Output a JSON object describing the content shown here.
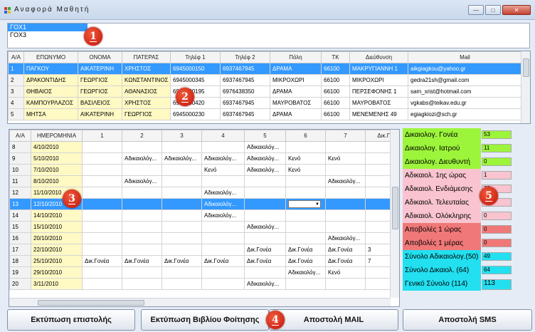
{
  "window": {
    "title": "Αναφορά Μαθητή",
    "icon": "app-icon"
  },
  "classes": {
    "items": [
      "ΓΟΧ1",
      "ΓΟΧ3"
    ],
    "selected": 0
  },
  "students": {
    "columns": [
      "Α/Α",
      "ΕΠΩΝΥΜΟ",
      "ΟΝΟΜΑ",
      "ΠΑΤΕΡΑΣ",
      "Τηλέφ 1",
      "Τηλέφ 2",
      "Πόλη",
      "ΤΚ",
      "Διεύθυνση",
      "Mail"
    ],
    "rows": [
      [
        "1",
        "ΠΑΓΚΟΥ",
        "ΑΙΚΑΤΕΡΙΝΗ",
        "ΧΡΗΣΤΟΣ",
        "6945000150",
        "6937467945",
        "ΔΡΑΜΑ",
        "66100",
        "ΜΑΚΡΥΓΙΑΝΝΗ 1",
        "aikgiagkou@yahoo.gr"
      ],
      [
        "2",
        "ΔΡΑΚΟΝΤΙΔΗΣ",
        "ΓΕΩΡΓΙΟΣ",
        "ΚΩΝΣΤΑΝΤΙΝΟΣ",
        "6945000345",
        "6937467945",
        "ΜΙΚΡΟΧΩΡΙ",
        "66100",
        "ΜΙΚΡΟΧΩΡΙ",
        "gedra21sh@gmail.com"
      ],
      [
        "3",
        "ΘΗΒΑΙΟΣ",
        "ΓΕΩΡΓΙΟΣ",
        "ΑΘΑΝΑΣΙΟΣ",
        "6945000195",
        "6976438350",
        "ΔΡΑΜΑ",
        "66100",
        "ΠΕΡΣΕΦΟΝΗΣ 1",
        "sam_xrist@hotmail.com"
      ],
      [
        "4",
        "ΚΑΜΠΟΥΡΛΑΖΟΣ",
        "ΒΑΣΙΛΕΙΟΣ",
        "ΧΡΗΣΤΟΣ",
        "6945000420",
        "6937467945",
        "ΜΑΥΡΟΒΑΤΟΣ",
        "66100",
        "ΜΑΥΡΟΒΑΤΟΣ",
        "vgkabs@teikav.edu.gr"
      ],
      [
        "5",
        "ΜΗΤΣΑ",
        "ΑΙΚΑΤΕΡΙΝΗ",
        "ΓΕΩΡΓΙΟΣ",
        "6945000230",
        "6937467945",
        "ΔΡΑΜΑ",
        "66100",
        "ΜΕΝΕΜΕΝΗΣ 49",
        "egiagkiozi@sch.gr"
      ]
    ],
    "selected_row": 0
  },
  "attendance": {
    "columns": [
      "Α/Α",
      "ΗΜΕΡΟΜΗΝΙΑ",
      "1",
      "2",
      "3",
      "4",
      "5",
      "6",
      "7",
      "Δικ.Γον"
    ],
    "rows": [
      [
        "8",
        "4/10/2010",
        "",
        "",
        "",
        "",
        "Αδικαιολόγ...",
        "",
        "",
        ""
      ],
      [
        "9",
        "5/10/2010",
        "",
        "Αδικαιολόγ...",
        "Αδικαιολόγ...",
        "Αδικαιολόγ...",
        "Αδικαιολόγ...",
        "Κενό",
        "Κενό",
        ""
      ],
      [
        "10",
        "7/10/2010",
        "",
        "",
        "",
        "Κενό",
        "Αδικαιολόγ...",
        "Κενό",
        "",
        ""
      ],
      [
        "11",
        "8/10/2010",
        "",
        "Αδικαιολόγ...",
        "",
        "",
        "",
        "",
        "Αδικαιολόγ...",
        ""
      ],
      [
        "12",
        "11/10/2010",
        "",
        "",
        "",
        "Αδικαιολόγ...",
        "",
        "",
        "",
        ""
      ],
      [
        "13",
        "12/10/2010",
        "",
        "",
        "",
        "Αδικαιολόγ...",
        "",
        "",
        "",
        ""
      ],
      [
        "14",
        "14/10/2010",
        "",
        "",
        "",
        "Αδικαιολόγ...",
        "",
        "",
        "",
        ""
      ],
      [
        "15",
        "15/10/2010",
        "",
        "",
        "",
        "",
        "Αδικαιολόγ...",
        "",
        "",
        ""
      ],
      [
        "16",
        "20/10/2010",
        "",
        "",
        "",
        "",
        "",
        "",
        "Αδικαιολόγ...",
        ""
      ],
      [
        "17",
        "22/10/2010",
        "",
        "",
        "",
        "",
        "Δικ.Γονέα",
        "Δικ.Γονέα",
        "Δικ.Γονέα",
        "3"
      ],
      [
        "18",
        "25/10/2010",
        "Δικ.Γονέα",
        "Δικ.Γονέα",
        "Δικ.Γονέα",
        "Δικ.Γονέα",
        "Δικ.Γονέα",
        "Δικ.Γονέα",
        "Δικ.Γονέα",
        "7"
      ],
      [
        "19",
        "29/10/2010",
        "",
        "",
        "",
        "",
        "",
        "Αδικαιολόγ...",
        "Κενό",
        ""
      ],
      [
        "20",
        "3/11/2010",
        "",
        "",
        "",
        "",
        "Αδικαιολόγ...",
        "",
        "",
        ""
      ]
    ],
    "selected_row": 5
  },
  "stats": [
    {
      "label": "Δικαιολογ. Γονέα",
      "value": "53",
      "color": "#9cf53a"
    },
    {
      "label": "Δικαιολογ. Ιατρού",
      "value": "11",
      "color": "#9cf53a"
    },
    {
      "label": "Δικαιολογ. Διευθυντή",
      "value": "0",
      "color": "#9cf53a"
    },
    {
      "label": "Αδικαιολ. 1ης ώρας",
      "value": "1",
      "color": "#f9c4cf"
    },
    {
      "label": "Αδικαιολ. Ενδιάμεσης",
      "value": "38",
      "color": "#f9c4cf"
    },
    {
      "label": "Αδικαιολ. Τελευταίας",
      "value": "10",
      "color": "#f9c4cf"
    },
    {
      "label": "Αδικαιολ. Ολόκληρης",
      "value": "0",
      "color": "#f9c4cf"
    },
    {
      "label": "Αποβολές 1 ώρας",
      "value": "0",
      "color": "#f07878"
    },
    {
      "label": "Αποβολές 1 μέρας",
      "value": "0",
      "color": "#f07878"
    },
    {
      "label": "Σύνολο Αδικαιολογ.(50)",
      "value": "49",
      "color": "#22e0f0"
    },
    {
      "label": "Σύνολο Δικαιολ.   (64)",
      "value": "64",
      "color": "#22e0f0"
    },
    {
      "label": "Γενικό Σύνολο    (114)",
      "value": "113",
      "color": "#22e0f0"
    }
  ],
  "buttons": {
    "print_letter": "Εκτύπωση επιστολής",
    "print_book": "Εκτύπωση Βιβλίου Φοίτησης",
    "send_mail": "Αποστολή MAIL",
    "send_sms": "Αποστολή SMS"
  },
  "markers": [
    "1",
    "2",
    "3",
    "4",
    "5"
  ],
  "colors": {
    "selection": "#3399ff",
    "marker": "#d42010",
    "name_cells": "#fff9c4"
  }
}
